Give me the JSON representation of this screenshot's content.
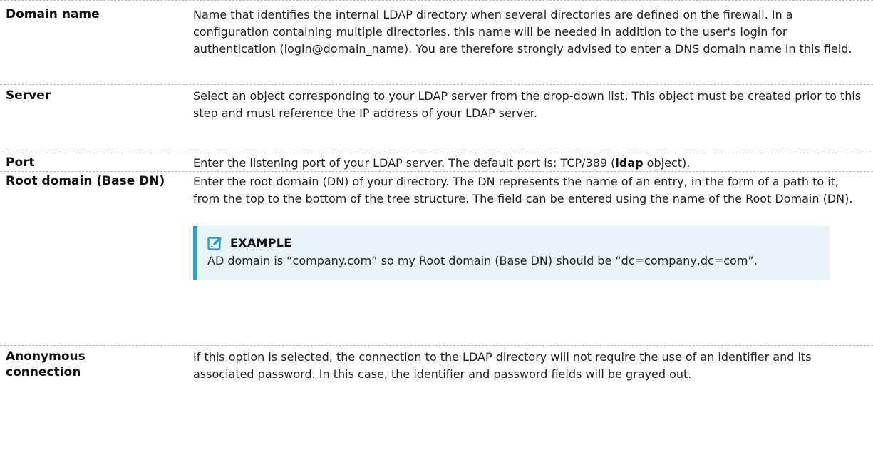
{
  "rows": [
    {
      "term": "Domain name",
      "desc": "Name that identifies the internal LDAP directory when several directories are defined on the firewall. In a configuration containing multiple directories, this name will be needed in addition to the user's login for authentication (login@domain_name). You are therefore strongly advised to enter a DNS domain name in this field."
    },
    {
      "term": "Server",
      "desc": "Select an object corresponding to your LDAP server from the drop-down list. This object must be created prior to this step and must reference the IP address of your LDAP server."
    },
    {
      "term": "Port",
      "desc_before": "Enter the listening port of your LDAP server. The default port is: TCP/389 (",
      "desc_bold": "ldap",
      "desc_after": " object)."
    },
    {
      "term": "Root domain (Base DN)",
      "desc": "Enter the root domain (DN) of your directory. The DN represents the name of an entry, in the form of a path to it, from the top to the bottom of the tree structure. The field can be entered using the name of the Root Domain (DN).",
      "example": {
        "icon": "edit-icon",
        "title": "EXAMPLE",
        "text": "AD domain is “company.com” so my Root domain (Base DN) should be “dc=company,dc=com”."
      }
    },
    {
      "term": "Anonymous connection",
      "desc": "If this option is selected, the connection to the LDAP directory will not require the use of an identifier and its associated password. In this case, the identifier and password fields will be grayed out."
    }
  ],
  "colors": {
    "example_bg": "#e8f3fa",
    "example_border": "#2a9fd8",
    "icon": "#2a9fd8"
  }
}
